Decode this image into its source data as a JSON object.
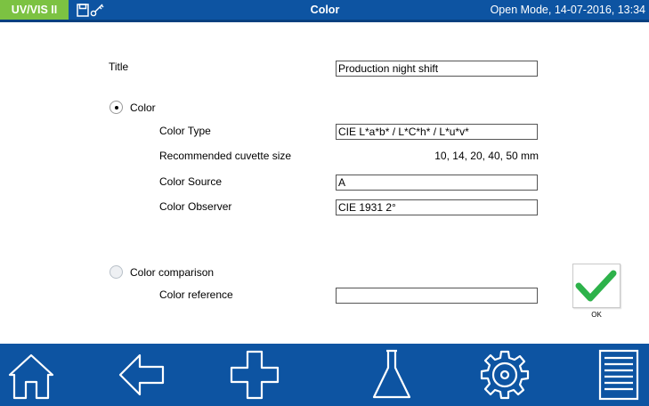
{
  "status_bar": {
    "app_badge": "UV/VIS II",
    "icons": [
      "save-icon",
      "key-icon"
    ],
    "title": "Color",
    "status_text": "Open Mode, 14-07-2016, 13:34"
  },
  "form": {
    "title_label": "Title",
    "title_value": "Production night shift",
    "color_option": {
      "label": "Color",
      "selected": true
    },
    "color_type_label": "Color Type",
    "color_type_value": "CIE L*a*b* / L*C*h* / L*u*v*",
    "cuvette_label": "Recommended cuvette size",
    "cuvette_value": "10, 14, 20, 40, 50 mm",
    "color_source_label": "Color Source",
    "color_source_value": "A",
    "color_observer_label": "Color Observer",
    "color_observer_value": "CIE 1931 2°",
    "comparison_option": {
      "label": "Color comparison",
      "selected": false
    },
    "color_reference_label": "Color reference",
    "color_reference_value": ""
  },
  "ok_button": {
    "label": "OK",
    "icon": "checkmark-icon"
  },
  "bottom_nav": {
    "items": [
      "home-icon",
      "back-arrow-icon",
      "plus-icon",
      "flask-icon",
      "gear-icon",
      "menu-list-icon"
    ]
  },
  "colors": {
    "bar_blue": "#0d54a2",
    "badge_green": "#7cc242",
    "check_green": "#2db24a"
  }
}
